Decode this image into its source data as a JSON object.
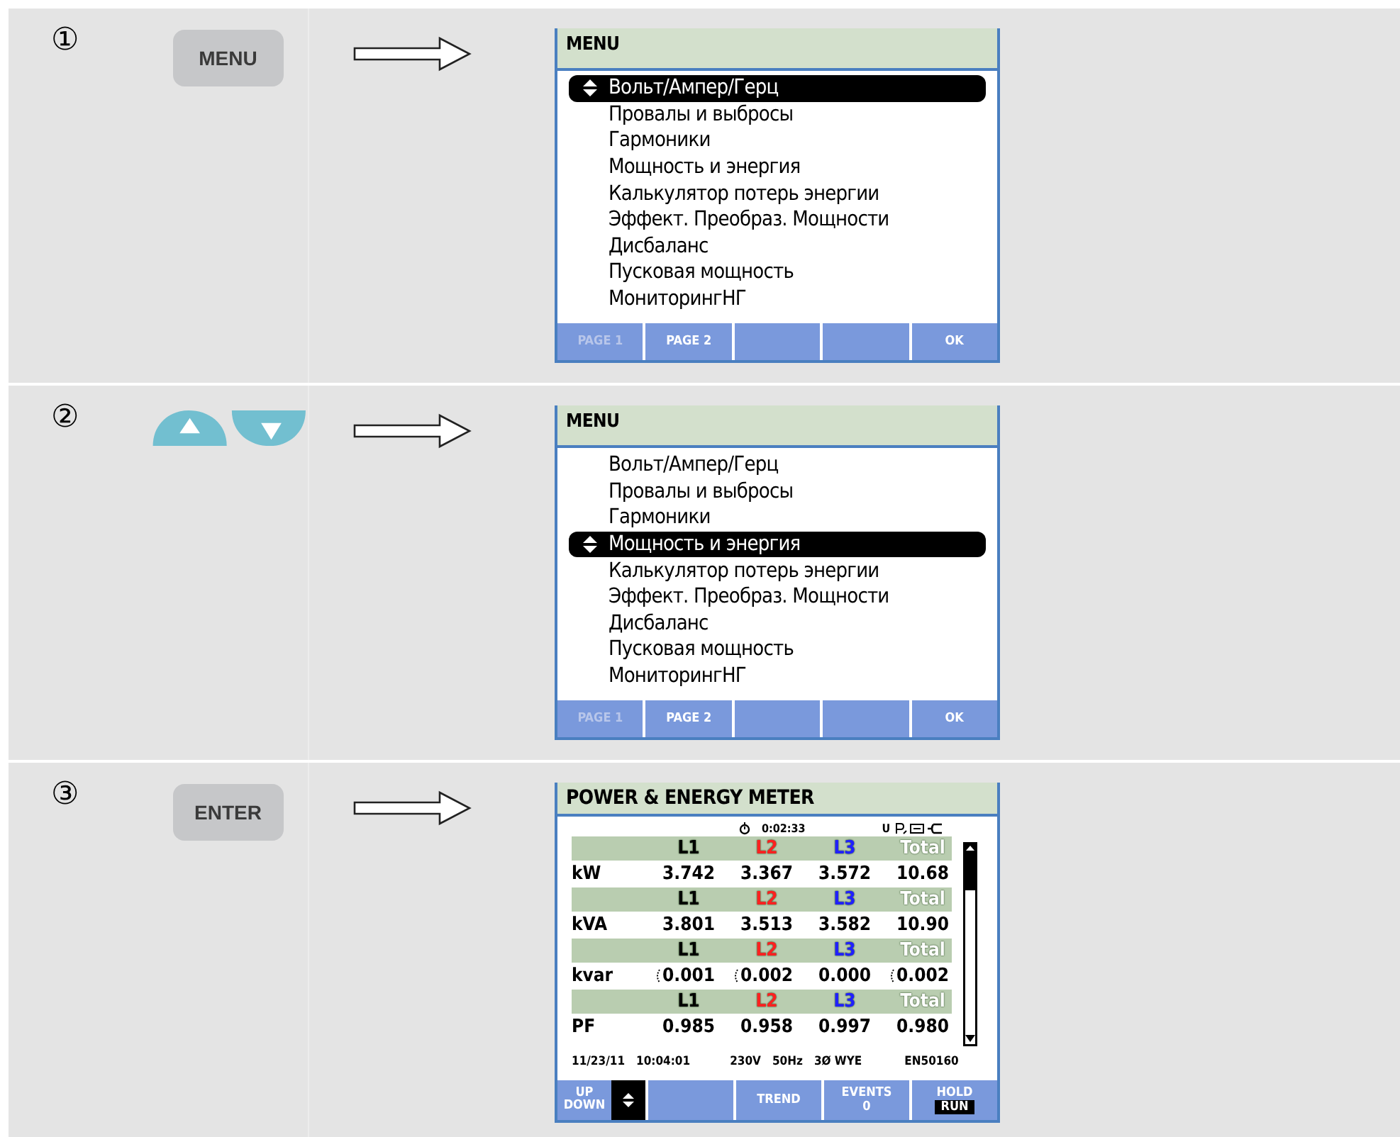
{
  "steps": [
    {
      "number": "①",
      "key": {
        "kind": "text",
        "label": "MENU"
      },
      "screen": {
        "kind": "menu",
        "title": "MENU",
        "items": [
          {
            "label": "Вольт/Ампер/Герц",
            "selected": true
          },
          {
            "label": "Провалы и выбросы",
            "selected": false
          },
          {
            "label": "Гармоники",
            "selected": false
          },
          {
            "label": "Мощность и энергия",
            "selected": false
          },
          {
            "label": "Калькулятор потерь энергии",
            "selected": false
          },
          {
            "label": "Эффект. Преобраз. Мощности",
            "selected": false
          },
          {
            "label": "Дисбаланс",
            "selected": false
          },
          {
            "label": "Пусковая мощность",
            "selected": false
          },
          {
            "label": "МониторингНГ",
            "selected": false
          }
        ],
        "softkeys": [
          {
            "kind": "label",
            "label": "PAGE 1",
            "disabled": true
          },
          {
            "kind": "label",
            "label": "PAGE 2",
            "disabled": false
          },
          {
            "kind": "blank"
          },
          {
            "kind": "blank"
          },
          {
            "kind": "label",
            "label": "OK",
            "disabled": false
          }
        ]
      }
    },
    {
      "number": "②",
      "key": {
        "kind": "arrows"
      },
      "screen": {
        "kind": "menu",
        "title": "MENU",
        "items": [
          {
            "label": "Вольт/Ампер/Герц",
            "selected": false
          },
          {
            "label": "Провалы и выбросы",
            "selected": false
          },
          {
            "label": "Гармоники",
            "selected": false
          },
          {
            "label": "Мощность и энергия",
            "selected": true
          },
          {
            "label": "Калькулятор потерь энергии",
            "selected": false
          },
          {
            "label": "Эффект. Преобраз. Мощности",
            "selected": false
          },
          {
            "label": "Дисбаланс",
            "selected": false
          },
          {
            "label": "Пусковая мощность",
            "selected": false
          },
          {
            "label": "МониторингНГ",
            "selected": false
          }
        ],
        "softkeys": [
          {
            "kind": "label",
            "label": "PAGE 1",
            "disabled": true
          },
          {
            "kind": "label",
            "label": "PAGE 2",
            "disabled": false
          },
          {
            "kind": "blank"
          },
          {
            "kind": "blank"
          },
          {
            "kind": "label",
            "label": "OK",
            "disabled": false
          }
        ]
      }
    },
    {
      "number": "③",
      "key": {
        "kind": "text",
        "label": "ENTER"
      },
      "screen": {
        "kind": "meter",
        "title": "POWER & ENERGY METER",
        "timer": "0:02:33",
        "status_letter": "U",
        "groups": [
          {
            "header": [
              {
                "label": "L1",
                "color": "#000000"
              },
              {
                "label": "L2",
                "color": "#ff2020"
              },
              {
                "label": "L3",
                "color": "#2020ff"
              },
              {
                "label": "Total",
                "color": "#ffffff"
              }
            ],
            "unit": "kW",
            "values": [
              {
                "text": "3.742",
                "capacitive": false
              },
              {
                "text": "3.367",
                "capacitive": false
              },
              {
                "text": "3.572",
                "capacitive": false
              },
              {
                "text": "10.68",
                "capacitive": false
              }
            ]
          },
          {
            "header": [
              {
                "label": "L1",
                "color": "#000000"
              },
              {
                "label": "L2",
                "color": "#ff2020"
              },
              {
                "label": "L3",
                "color": "#2020ff"
              },
              {
                "label": "Total",
                "color": "#ffffff"
              }
            ],
            "unit": "kVA",
            "values": [
              {
                "text": "3.801",
                "capacitive": false
              },
              {
                "text": "3.513",
                "capacitive": false
              },
              {
                "text": "3.582",
                "capacitive": false
              },
              {
                "text": "10.90",
                "capacitive": false
              }
            ]
          },
          {
            "header": [
              {
                "label": "L1",
                "color": "#000000"
              },
              {
                "label": "L2",
                "color": "#ff2020"
              },
              {
                "label": "L3",
                "color": "#2020ff"
              },
              {
                "label": "Total",
                "color": "#ffffff"
              }
            ],
            "unit": "kvar",
            "values": [
              {
                "text": "0.001",
                "capacitive": true
              },
              {
                "text": "0.002",
                "capacitive": true
              },
              {
                "text": "0.000",
                "capacitive": false
              },
              {
                "text": "0.002",
                "capacitive": true
              }
            ]
          },
          {
            "header": [
              {
                "label": "L1",
                "color": "#000000"
              },
              {
                "label": "L2",
                "color": "#ff2020"
              },
              {
                "label": "L3",
                "color": "#2020ff"
              },
              {
                "label": "Total",
                "color": "#ffffff"
              }
            ],
            "unit": "PF",
            "values": [
              {
                "text": "0.985",
                "capacitive": false
              },
              {
                "text": "0.958",
                "capacitive": false
              },
              {
                "text": "0.997",
                "capacitive": false
              },
              {
                "text": "0.980",
                "capacitive": false
              }
            ]
          }
        ],
        "footer": [
          "11/23/11",
          "10:04:01",
          "230V",
          "50Hz",
          "3Ø WYE",
          "EN50160"
        ],
        "softkeys": [
          {
            "kind": "updown",
            "label": "UP DOWN"
          },
          {
            "kind": "blank"
          },
          {
            "kind": "text",
            "label": "TREND"
          },
          {
            "kind": "text",
            "label": "EVENTS",
            "sub": "0"
          },
          {
            "kind": "hold",
            "label": "HOLD",
            "sub": "RUN"
          }
        ]
      }
    }
  ]
}
